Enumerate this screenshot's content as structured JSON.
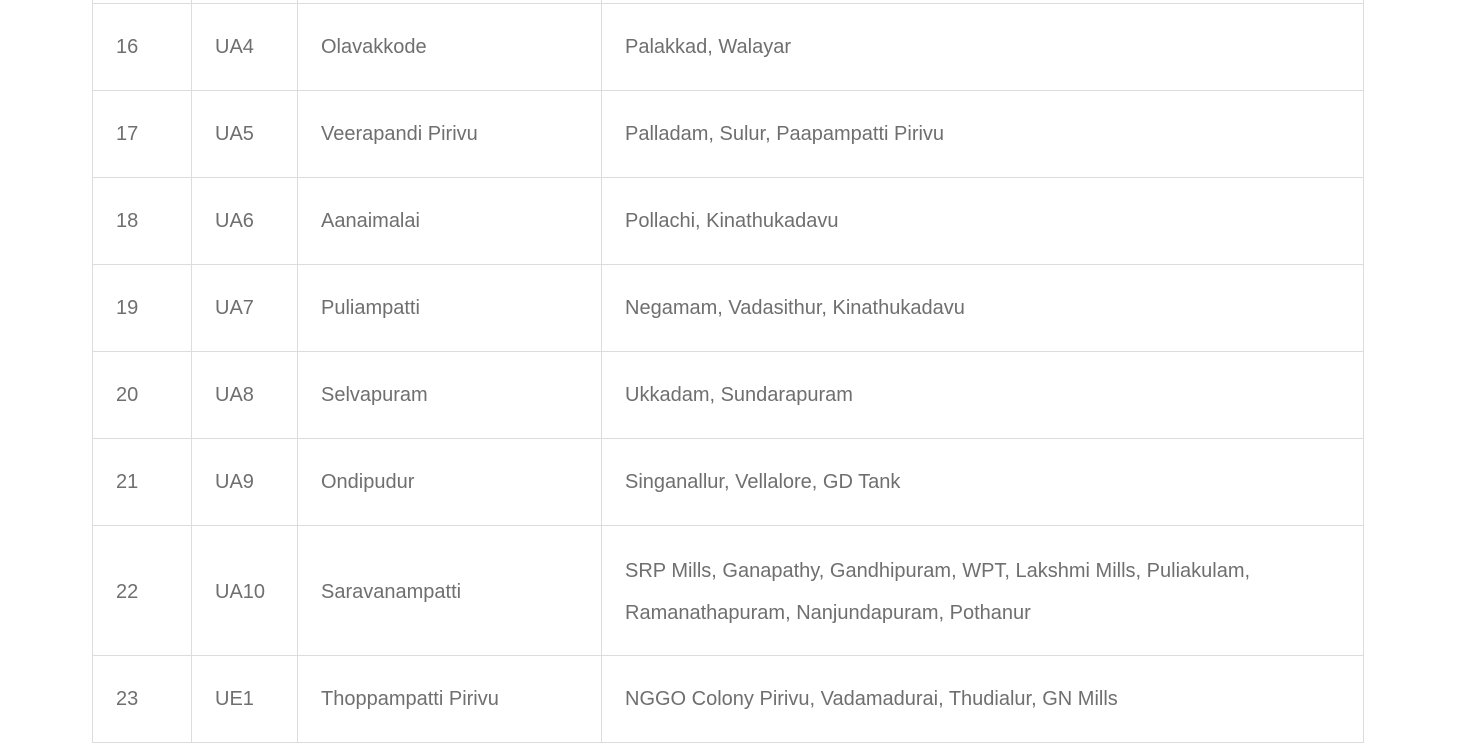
{
  "table": {
    "rows": [
      {
        "no": "",
        "code": "",
        "from": "",
        "via": ""
      },
      {
        "no": "16",
        "code": "UA4",
        "from": "Olavakkode",
        "via": "Palakkad, Walayar"
      },
      {
        "no": "17",
        "code": "UA5",
        "from": "Veerapandi Pirivu",
        "via": "Palladam, Sulur, Paapampatti Pirivu"
      },
      {
        "no": "18",
        "code": "UA6",
        "from": "Aanaimalai",
        "via": "Pollachi, Kinathukadavu"
      },
      {
        "no": "19",
        "code": "UA7",
        "from": "Puliampatti",
        "via": "Negamam, Vadasithur, Kinathukadavu"
      },
      {
        "no": "20",
        "code": "UA8",
        "from": "Selvapuram",
        "via": "Ukkadam, Sundarapuram"
      },
      {
        "no": "21",
        "code": "UA9",
        "from": "Ondipudur",
        "via": "Singanallur, Vellalore, GD Tank"
      },
      {
        "no": "22",
        "code": "UA10",
        "from": "Saravanampatti",
        "via": "SRP Mills, Ganapathy, Gandhipuram, WPT, Lakshmi Mills, Puliakulam, Ramanathapuram, Nanjundapuram, Pothanur"
      },
      {
        "no": "23",
        "code": "UE1",
        "from": "Thoppampatti Pirivu",
        "via": "NGGO Colony Pirivu, Vadamadurai, Thudialur, GN Mills"
      }
    ]
  }
}
